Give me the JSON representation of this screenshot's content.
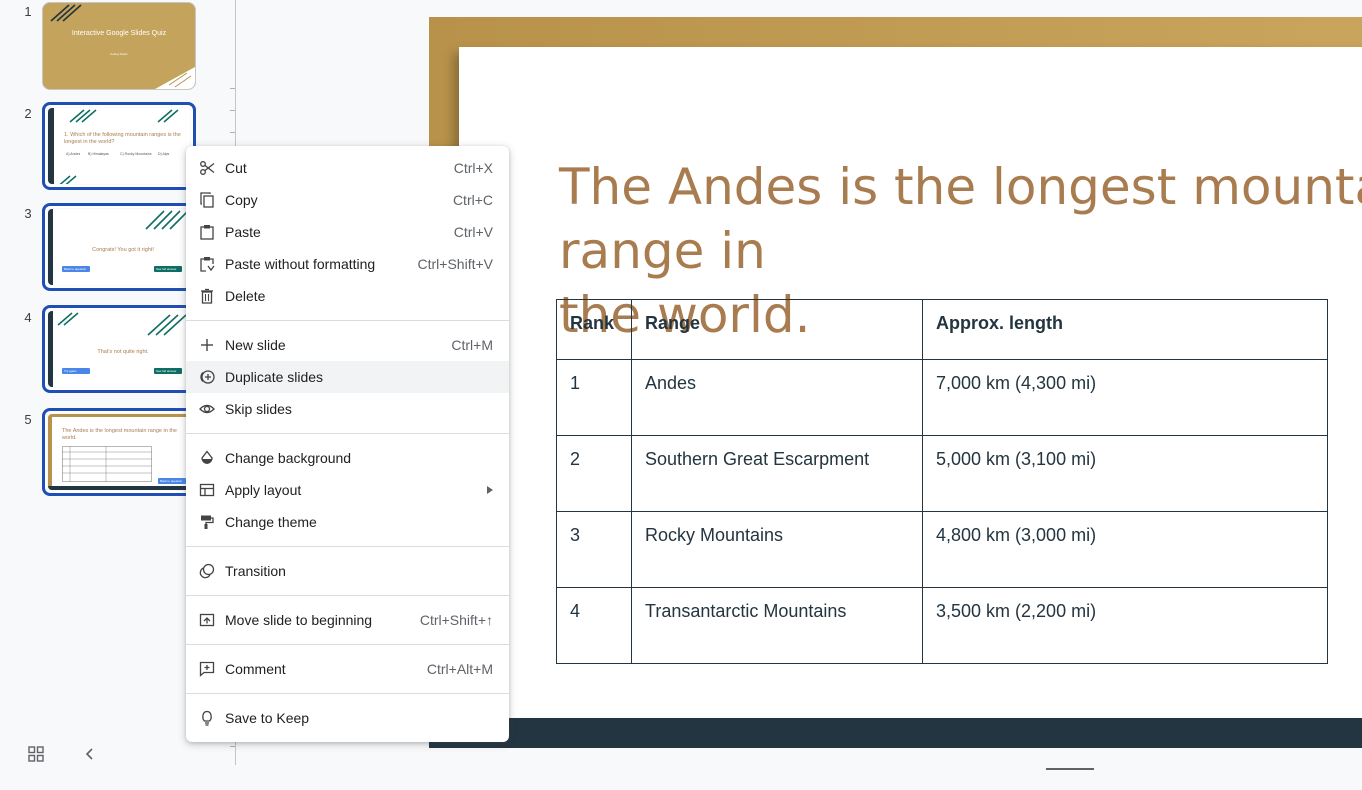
{
  "filmstrip": {
    "slides": [
      {
        "number": "1",
        "title": "Interactive Google Slides Quiz",
        "subtitle": "Kelsey Davis"
      },
      {
        "number": "2",
        "question": "1.   Which of the following mountain ranges is the longest in the world?",
        "options": [
          "A) Andes",
          "B) Himalayas",
          "C) Rocky Mountains",
          "D) Alps"
        ]
      },
      {
        "number": "3",
        "text": "Congrats! You got it right!",
        "left_button": "Back to question",
        "right_button": "See full answer"
      },
      {
        "number": "4",
        "text": "That's not quite right.",
        "left_button": "Try again",
        "right_button": "See full answer"
      },
      {
        "number": "5",
        "title": "The Andes is the longest mountain range in the world.",
        "button": "Back to question"
      }
    ]
  },
  "slide": {
    "title": "The Andes is the longest mountain range in\nthe world.",
    "table": {
      "headers": [
        "Rank",
        "Range",
        "Approx. length"
      ],
      "rows": [
        [
          "1",
          "Andes",
          "7,000 km (4,300 mi)"
        ],
        [
          "2",
          "Southern Great Escarpment",
          "5,000 km (3,100 mi)"
        ],
        [
          "3",
          "Rocky Mountains",
          "4,800 km (3,000 mi)"
        ],
        [
          "4",
          "Transantarctic Mountains",
          "3,500 km (2,200 mi)"
        ]
      ]
    }
  },
  "menu": {
    "cut": {
      "label": "Cut",
      "shortcut": "Ctrl+X",
      "icon": "scissors-icon"
    },
    "copy": {
      "label": "Copy",
      "shortcut": "Ctrl+C",
      "icon": "copy-icon"
    },
    "paste": {
      "label": "Paste",
      "shortcut": "Ctrl+V",
      "icon": "clipboard-icon"
    },
    "paste_plain": {
      "label": "Paste without formatting",
      "shortcut": "Ctrl+Shift+V",
      "icon": "clipboard-plain-icon"
    },
    "delete": {
      "label": "Delete",
      "shortcut": "",
      "icon": "trash-icon"
    },
    "new_slide": {
      "label": "New slide",
      "shortcut": "Ctrl+M",
      "icon": "plus-icon"
    },
    "duplicate": {
      "label": "Duplicate slides",
      "shortcut": "",
      "icon": "duplicate-icon"
    },
    "skip": {
      "label": "Skip slides",
      "shortcut": "",
      "icon": "eye-icon"
    },
    "background": {
      "label": "Change background",
      "shortcut": "",
      "icon": "fill-drop-icon"
    },
    "layout": {
      "label": "Apply layout",
      "shortcut": "",
      "icon": "layout-icon"
    },
    "theme": {
      "label": "Change theme",
      "shortcut": "",
      "icon": "paint-roller-icon"
    },
    "transition": {
      "label": "Transition",
      "shortcut": "",
      "icon": "transition-icon"
    },
    "move_begin": {
      "label": "Move slide to beginning",
      "shortcut": "Ctrl+Shift+↑",
      "icon": "move-up-icon"
    },
    "comment": {
      "label": "Comment",
      "shortcut": "Ctrl+Alt+M",
      "icon": "comment-icon"
    },
    "keep": {
      "label": "Save to Keep",
      "shortcut": "",
      "icon": "lightbulb-icon"
    }
  },
  "colors": {
    "accent_gold": "#b8924a",
    "title_brown": "#a97c50",
    "dark_navy": "#233540",
    "selection_blue": "#1f4fb4",
    "teal": "#0e6e63",
    "button_blue": "#4a86e8"
  }
}
